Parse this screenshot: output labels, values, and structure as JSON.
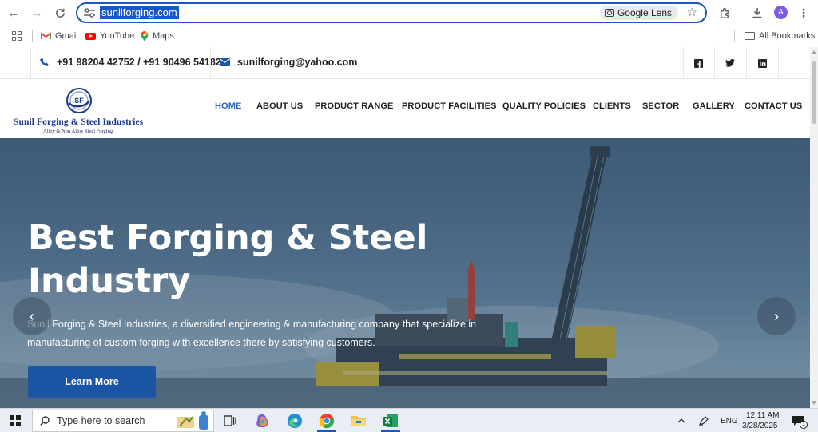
{
  "browser": {
    "url": "sunilforging.com",
    "lens_label": "Google Lens",
    "avatar_letter": "A",
    "bookmarks": [
      {
        "label": "Gmail"
      },
      {
        "label": "YouTube"
      },
      {
        "label": "Maps"
      }
    ],
    "all_bookmarks_label": "All Bookmarks"
  },
  "site": {
    "phone": "+91 98204 42752 / +91 90496 54182",
    "email": "sunilforging@yahoo.com",
    "social": {
      "facebook": "f",
      "twitter": "t",
      "linkedin": "in"
    },
    "logo": {
      "mark": "SF",
      "title": "Sunil Forging & Steel Industries",
      "subtitle": "Alloy & Non Alloy Steel Forging"
    },
    "menu": [
      "HOME",
      "ABOUT US",
      "PRODUCT RANGE",
      "PRODUCT FACILITIES",
      "QUALITY POLICIES",
      "CLIENTS",
      "SECTOR",
      "GALLERY",
      "CONTACT US"
    ],
    "hero": {
      "title": "Best Forging & Steel Industry",
      "description": "Sunil Forging & Steel Industries, a diversified engineering & manufacturing company that specialize in manufacturing of custom forging with excellence there by satisfying customers.",
      "button_label": "Learn More"
    }
  },
  "taskbar": {
    "search_placeholder": "Type here to search",
    "language": "ENG",
    "time": "12:11 AM",
    "date": "3/28/2025",
    "notification_count": "1"
  },
  "colors": {
    "accent": "#1a56c4",
    "menu_active": "#2a66b5",
    "button": "#1d55a6",
    "logo_blue": "#1d3a8a"
  }
}
